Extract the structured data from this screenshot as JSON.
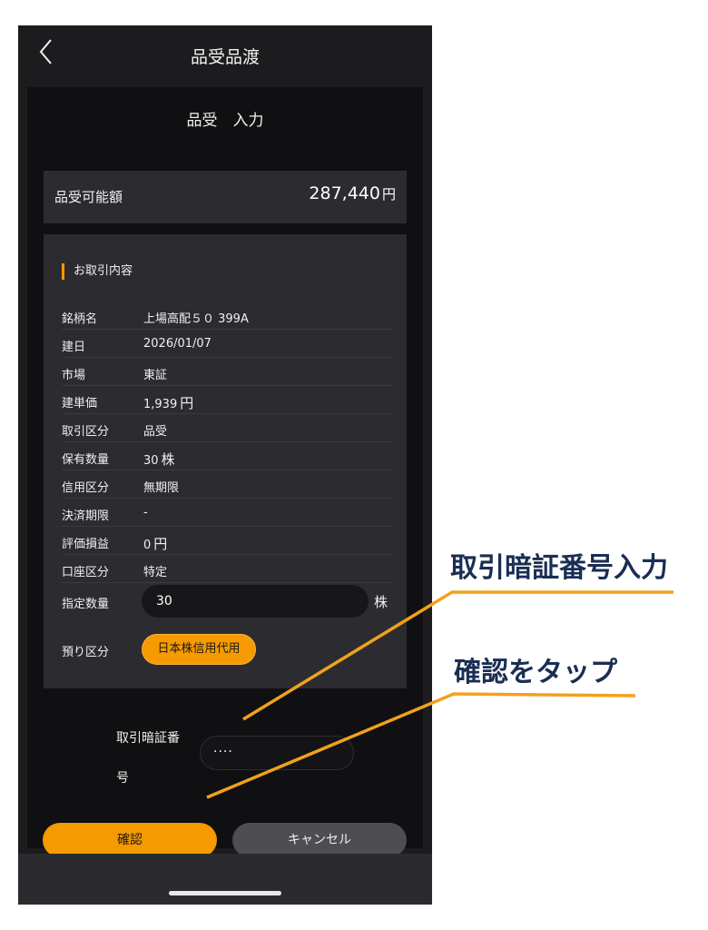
{
  "topbar": {
    "title": "品受品渡"
  },
  "panel": {
    "title": "品受　入力"
  },
  "available": {
    "label": "品受可能額",
    "value": "287,440",
    "unit": "円"
  },
  "details": {
    "section_title": "お取引内容",
    "rows": [
      {
        "label": "銘柄名",
        "value": "上場高配５０ 399A",
        "unit": ""
      },
      {
        "label": "建日",
        "value": "2026/01/07",
        "unit": ""
      },
      {
        "label": "市場",
        "value": "東証",
        "unit": ""
      },
      {
        "label": "建単価",
        "value": "1,939",
        "unit": "円"
      },
      {
        "label": "取引区分",
        "value": "品受",
        "unit": ""
      },
      {
        "label": "保有数量",
        "value": "30",
        "unit": "株"
      },
      {
        "label": "信用区分",
        "value": "無期限",
        "unit": ""
      },
      {
        "label": "決済期限",
        "value": "-",
        "unit": ""
      },
      {
        "label": "評価損益",
        "value": "0",
        "unit": "円"
      },
      {
        "label": "口座区分",
        "value": "特定",
        "unit": ""
      }
    ],
    "quantity": {
      "label": "指定数量",
      "value": "30",
      "unit": "株"
    },
    "deposit": {
      "label": "預り区分",
      "option": "日本株信用代用"
    }
  },
  "password": {
    "label_line1": "取引暗証番",
    "label_line2": "号",
    "masked_value": "····"
  },
  "buttons": {
    "confirm": "確認",
    "cancel": "キャンセル"
  },
  "annotations": {
    "password_hint": "取引暗証番号入力",
    "confirm_hint": "確認をタップ"
  },
  "colors": {
    "accent": "#f59a00",
    "annotation_text": "#1a2e53",
    "annotation_line": "#f2a11c",
    "background": "#1c1c1f"
  },
  "icons": {
    "back": "chevron-left-icon"
  }
}
